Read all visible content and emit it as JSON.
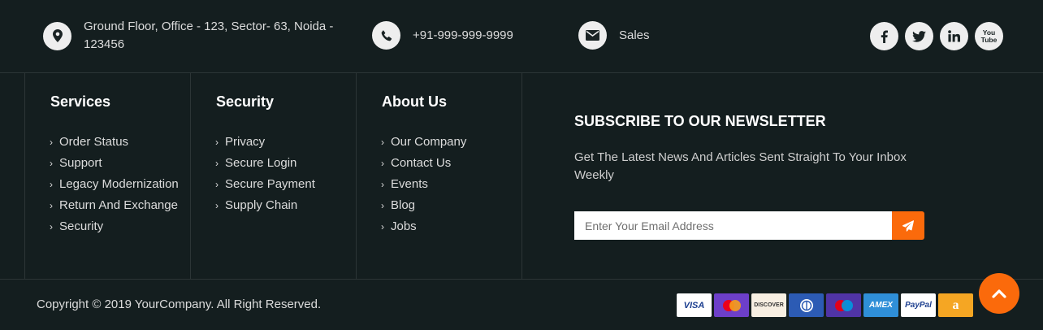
{
  "contact": {
    "address": "Ground Floor, Office - 123, Sector- 63, Noida - 123456",
    "phone": "+91-999-999-9999",
    "email_label": "Sales",
    "icons": [
      "map-marker-icon",
      "phone-icon",
      "envelope-icon"
    ]
  },
  "social": {
    "icons": [
      "facebook-icon",
      "twitter-icon",
      "linkedin-icon",
      "youtube-icon"
    ],
    "youtube_top": "You",
    "youtube_bottom": "Tube"
  },
  "columns": [
    {
      "title": "Services",
      "items": [
        "Order Status",
        "Support",
        "Legacy Modernization",
        "Return And Exchange",
        "Security"
      ]
    },
    {
      "title": "Security",
      "items": [
        "Privacy",
        "Secure Login",
        "Secure Payment",
        "Supply Chain"
      ]
    },
    {
      "title": "About Us",
      "items": [
        "Our Company",
        "Contact Us",
        "Events",
        "Blog",
        "Jobs"
      ]
    }
  ],
  "newsletter": {
    "title": "SUBSCRIBE TO OUR NEWSLETTER",
    "description": "Get The Latest News And Articles Sent Straight To Your Inbox Weekly",
    "placeholder": "Enter Your Email Address",
    "submit_icon": "paper-plane-icon"
  },
  "footer": {
    "copyright": "Copyright © 2019 YourCompany. All Right Reserved."
  },
  "payments": [
    {
      "name": "visa",
      "label": "VISA",
      "bg": "#ffffff",
      "fg": "#1a3d8f"
    },
    {
      "name": "mastercard",
      "label": "",
      "bg": "#6d3fc9",
      "fg": "#ffffff"
    },
    {
      "name": "discover",
      "label": "DISCOVER",
      "bg": "#f7efe2",
      "fg": "#333333"
    },
    {
      "name": "diners",
      "label": "",
      "bg": "#2c5bb4",
      "fg": "#ffffff"
    },
    {
      "name": "maestro",
      "label": "",
      "bg": "#5034a6",
      "fg": "#ffffff"
    },
    {
      "name": "amex",
      "label": "AMEX",
      "bg": "#2f8fd8",
      "fg": "#ffffff"
    },
    {
      "name": "paypal",
      "label": "PayPal",
      "bg": "#ffffff",
      "fg": "#1d3f8f"
    },
    {
      "name": "amazon",
      "label": "a",
      "bg": "#f5a623",
      "fg": "#ffffff"
    }
  ],
  "colors": {
    "background": "#141e1f",
    "accent": "#fb6a0b",
    "divider": "#2c3536"
  },
  "scroll_top_icon": "chevron-up-icon"
}
